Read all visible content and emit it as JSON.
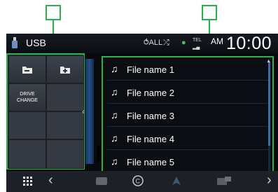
{
  "status_bar": {
    "source_label": "USB",
    "repeat_icon_text": "⥀ALL",
    "shuffle_icon_text": "⤮",
    "tel_label": "TEL",
    "clock_ampm": "AM",
    "clock_time": "10:00"
  },
  "left_panel": {
    "drive_change_label": "DRIVE CHANGE"
  },
  "file_list": {
    "items": [
      {
        "label": "File name 1"
      },
      {
        "label": "File name 2"
      },
      {
        "label": "File name 3"
      },
      {
        "label": "File name 4"
      },
      {
        "label": "File name 5"
      }
    ]
  },
  "bottom_bar": {
    "menu_icon": "grid-icon",
    "left_chevron": "‹",
    "right_chevron": "›"
  },
  "colors": {
    "callout_green": "#26b34a",
    "screen_bg": "#07090d",
    "accent_blue": "#3b6fa8"
  }
}
